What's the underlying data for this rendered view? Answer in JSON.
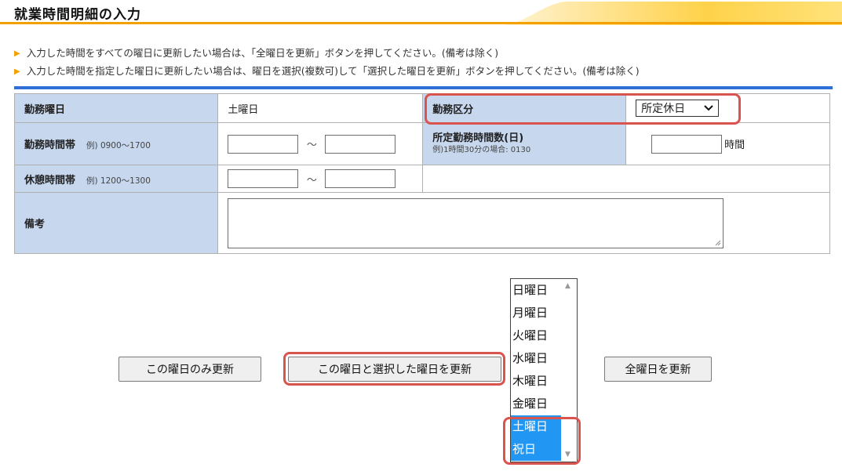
{
  "page": {
    "title": "就業時間明細の入力"
  },
  "notes": [
    "入力した時間をすべての曜日に更新したい場合は、「全曜日を更新」ボタンを押してください。(備考は除く)",
    "入力した時間を指定した曜日に更新したい場合は、曜日を選択(複数可)して「選択した曜日を更新」ボタンを押してください。(備考は除く)"
  ],
  "form": {
    "work_day_label": "勤務曜日",
    "work_day_value": "土曜日",
    "work_type_label": "勤務区分",
    "work_type_selected": "所定休日",
    "work_time_label": "勤務時間帯",
    "work_time_example": "例) 0900〜1700",
    "tilde": "〜",
    "scheduled_hours_label": "所定勤務時間数(日)",
    "scheduled_hours_example": "例)1時間30分の場合: 0130",
    "hours_unit": "時間",
    "break_time_label": "休憩時間帯",
    "break_time_example": "例) 1200〜1300",
    "remarks_label": "備考"
  },
  "buttons": {
    "update_this_day": "この曜日のみ更新",
    "update_this_and_selected": "この曜日と選択した曜日を更新",
    "update_all": "全曜日を更新"
  },
  "day_list": {
    "items": [
      "日曜日",
      "月曜日",
      "火曜日",
      "水曜日",
      "木曜日",
      "金曜日",
      "土曜日",
      "祝日"
    ],
    "selected": [
      "土曜日",
      "祝日"
    ]
  },
  "colors": {
    "accent_orange": "#f2a100",
    "header_blue": "#c7d7ee",
    "rule_blue": "#2f6fd6",
    "highlight_red": "#d9534f",
    "selection_blue": "#2196f3"
  }
}
